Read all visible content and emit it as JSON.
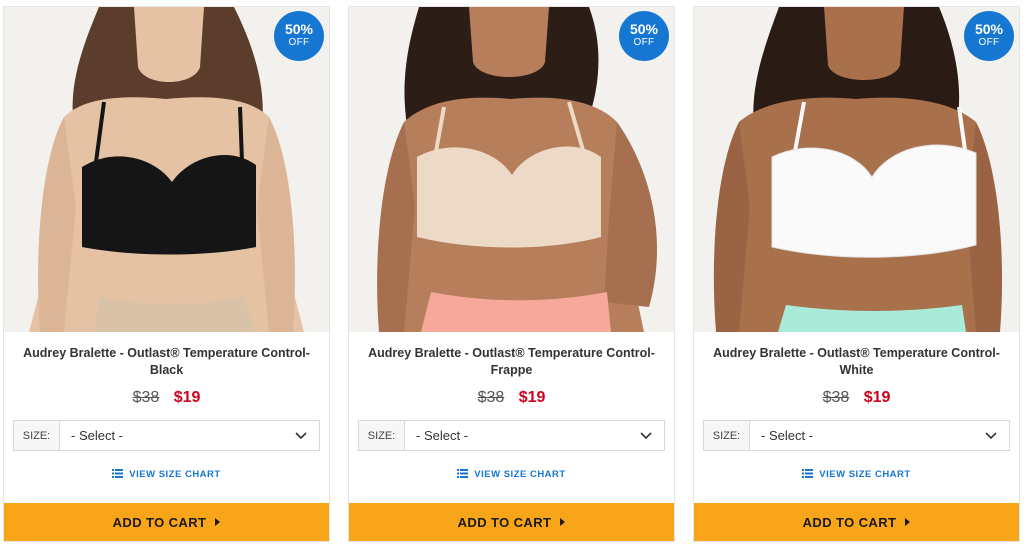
{
  "products": [
    {
      "badge_pct": "50%",
      "badge_off": "OFF",
      "title": "Audrey Bralette - Outlast® Temperature Control-Black",
      "old_price": "$38",
      "new_price": "$19",
      "size_label": "SIZE:",
      "size_value": "- Select -",
      "size_chart_label": "VIEW SIZE CHART",
      "add_to_cart_label": "ADD TO CART",
      "colors": {
        "garment": "#151515",
        "bottom": "#d8c3a8",
        "skin": "#e6c2a4",
        "hair": "#5c3d2c",
        "bg": "#f3f1ee"
      }
    },
    {
      "badge_pct": "50%",
      "badge_off": "OFF",
      "title": "Audrey Bralette - Outlast® Temperature Control-Frappe",
      "old_price": "$38",
      "new_price": "$19",
      "size_label": "SIZE:",
      "size_value": "- Select -",
      "size_chart_label": "VIEW SIZE CHART",
      "add_to_cart_label": "ADD TO CART",
      "colors": {
        "garment": "#ecdac6",
        "bottom": "#f6a89a",
        "skin": "#b67e5a",
        "hair": "#2c1d16",
        "bg": "#f3f1ee"
      }
    },
    {
      "badge_pct": "50%",
      "badge_off": "OFF",
      "title": "Audrey Bralette - Outlast® Temperature Control-White",
      "old_price": "$38",
      "new_price": "$19",
      "size_label": "SIZE:",
      "size_value": "- Select -",
      "size_chart_label": "VIEW SIZE CHART",
      "add_to_cart_label": "ADD TO CART",
      "colors": {
        "garment": "#fafafa",
        "bottom": "#a9ead8",
        "skin": "#a9704c",
        "hair": "#2a1b14",
        "bg": "#f3f1ee"
      }
    }
  ],
  "theme": {
    "accent": "#1677d2",
    "sale_red": "#d0021b",
    "cart_orange": "#f9a51a"
  }
}
